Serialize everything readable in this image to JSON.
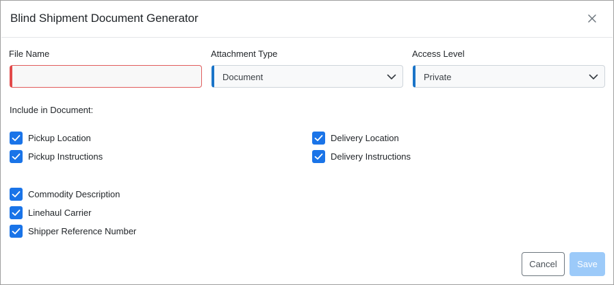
{
  "dialog": {
    "title": "Blind Shipment Document Generator",
    "close_icon": "close-icon"
  },
  "fields": {
    "file_name": {
      "label": "File Name",
      "value": "",
      "placeholder": ""
    },
    "attachment_type": {
      "label": "Attachment Type",
      "value": "Document"
    },
    "access_level": {
      "label": "Access Level",
      "value": "Private"
    }
  },
  "include": {
    "label": "Include in Document:",
    "items": [
      {
        "label": "Pickup Location",
        "checked": true
      },
      {
        "label": "Pickup Instructions",
        "checked": true
      },
      {
        "label": "Delivery Location",
        "checked": true
      },
      {
        "label": "Delivery Instructions",
        "checked": true
      },
      {
        "label": "Commodity Description",
        "checked": true
      },
      {
        "label": "Linehaul Carrier",
        "checked": true
      },
      {
        "label": "Shipper Reference Number",
        "checked": true
      }
    ]
  },
  "buttons": {
    "cancel": "Cancel",
    "save": "Save"
  },
  "colors": {
    "accent": "#1a74e8",
    "select_border": "#1a74c8",
    "error_border": "#e24a4a",
    "save_disabled": "#9ccaf9"
  }
}
